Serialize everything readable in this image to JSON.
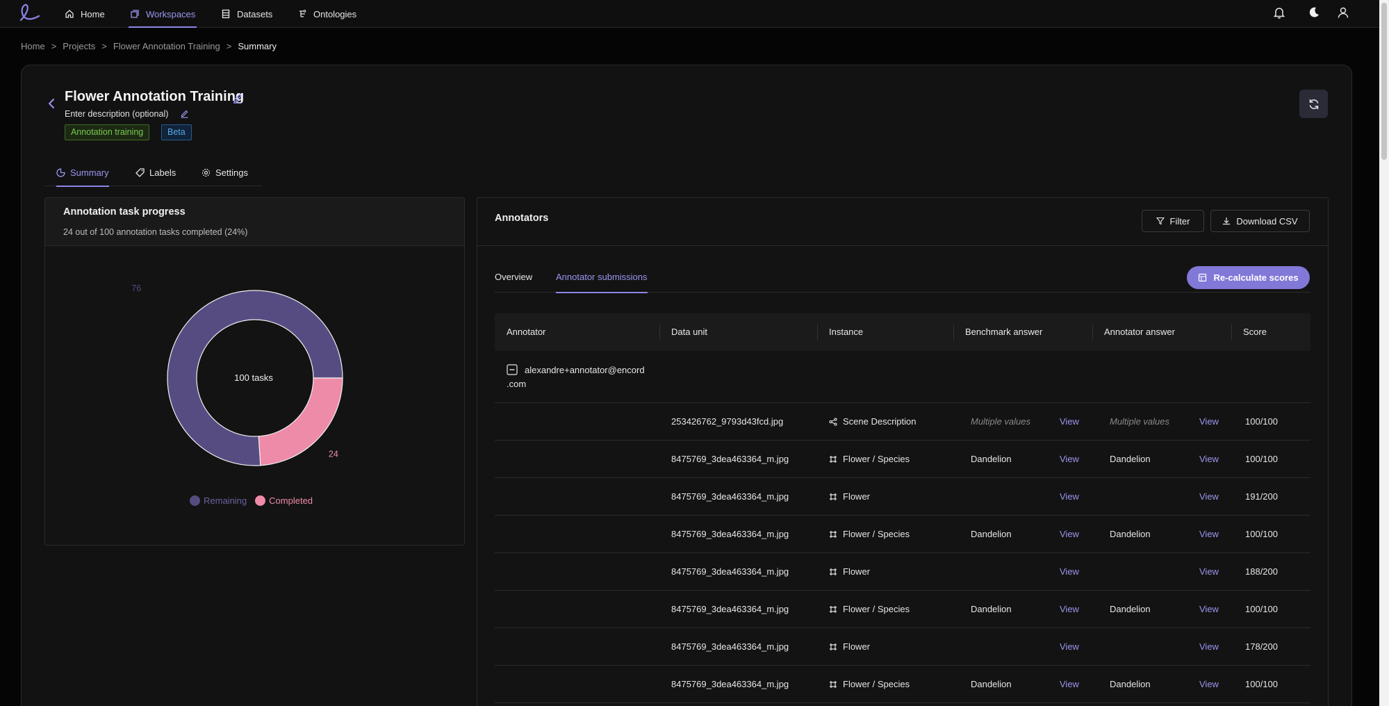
{
  "nav": {
    "items": [
      {
        "label": "Home",
        "icon": "home-icon"
      },
      {
        "label": "Workspaces",
        "icon": "workspaces-icon",
        "active": true
      },
      {
        "label": "Datasets",
        "icon": "datasets-icon"
      },
      {
        "label": "Ontologies",
        "icon": "ontologies-icon"
      }
    ],
    "right_icons": [
      "bell-icon",
      "moon-icon",
      "user-icon"
    ]
  },
  "breadcrumb": {
    "items": [
      "Home",
      "Projects",
      "Flower Annotation Training"
    ],
    "current": "Summary",
    "separator": ">"
  },
  "project": {
    "title": "Flower Annotation Training",
    "description": "Enter description (optional)",
    "tags": [
      "Annotation training",
      "Beta"
    ]
  },
  "tabs": [
    {
      "label": "Summary",
      "active": true
    },
    {
      "label": "Labels"
    },
    {
      "label": "Settings"
    }
  ],
  "progress": {
    "title": "Annotation task progress",
    "subtitle": "24 out of 100 annotation tasks completed (24%)",
    "center_label": "100 tasks",
    "remaining": 76,
    "completed": 24,
    "legend": [
      "Remaining",
      "Completed"
    ],
    "colors": {
      "remaining": "#574c82",
      "completed": "#ee8ba8"
    }
  },
  "chart_data": {
    "type": "pie",
    "categories": [
      "Remaining",
      "Completed"
    ],
    "values": [
      76,
      24
    ],
    "title": "",
    "donut": true,
    "center_label": "100 tasks",
    "legend_position": "bottom"
  },
  "annotators": {
    "title": "Annotators",
    "filter_label": "Filter",
    "download_label": "Download CSV",
    "subtabs": [
      {
        "label": "Overview"
      },
      {
        "label": "Annotator submissions",
        "active": true
      }
    ],
    "recalc_label": "Re-calculate scores",
    "columns": [
      "Annotator",
      "Data unit",
      "Instance",
      "Benchmark answer",
      "Annotator answer",
      "Score"
    ],
    "group_email_line1": "alexandre+annotator@encord",
    "group_email_line2": ".com",
    "rows": [
      {
        "data_unit": "253426762_9793d43fcd.jpg",
        "instance_icon": "graph-icon",
        "instance": "Scene Description",
        "benchmark": "Multiple values",
        "benchmark_muted": true,
        "bench_view": "View",
        "answer": "Multiple values",
        "answer_muted": true,
        "ans_view": "View",
        "score": "100/100"
      },
      {
        "data_unit": "8475769_3dea463364_m.jpg",
        "instance_icon": "bbox-icon",
        "instance": "Flower / Species",
        "benchmark": "Dandelion",
        "bench_view": "View",
        "answer": "Dandelion",
        "ans_view": "View",
        "score": "100/100"
      },
      {
        "data_unit": "8475769_3dea463364_m.jpg",
        "instance_icon": "bbox-icon",
        "instance": "Flower",
        "benchmark": "",
        "bench_view": "View",
        "answer": "",
        "ans_view": "View",
        "score": "191/200"
      },
      {
        "data_unit": "8475769_3dea463364_m.jpg",
        "instance_icon": "bbox-icon",
        "instance": "Flower / Species",
        "benchmark": "Dandelion",
        "bench_view": "View",
        "answer": "Dandelion",
        "ans_view": "View",
        "score": "100/100"
      },
      {
        "data_unit": "8475769_3dea463364_m.jpg",
        "instance_icon": "bbox-icon",
        "instance": "Flower",
        "benchmark": "",
        "bench_view": "View",
        "answer": "",
        "ans_view": "View",
        "score": "188/200"
      },
      {
        "data_unit": "8475769_3dea463364_m.jpg",
        "instance_icon": "bbox-icon",
        "instance": "Flower / Species",
        "benchmark": "Dandelion",
        "bench_view": "View",
        "answer": "Dandelion",
        "ans_view": "View",
        "score": "100/100"
      },
      {
        "data_unit": "8475769_3dea463364_m.jpg",
        "instance_icon": "bbox-icon",
        "instance": "Flower",
        "benchmark": "",
        "bench_view": "View",
        "answer": "",
        "ans_view": "View",
        "score": "178/200"
      },
      {
        "data_unit": "8475769_3dea463364_m.jpg",
        "instance_icon": "bbox-icon",
        "instance": "Flower / Species",
        "benchmark": "Dandelion",
        "bench_view": "View",
        "answer": "Dandelion",
        "ans_view": "View",
        "score": "100/100"
      }
    ]
  }
}
